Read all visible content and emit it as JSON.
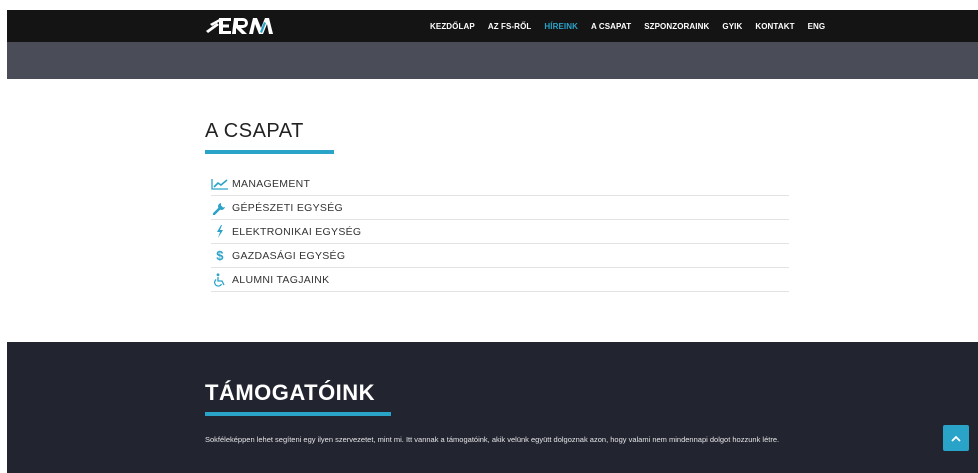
{
  "nav": {
    "logo_text": "ERM",
    "items": [
      {
        "label": "KEZDŐLAP"
      },
      {
        "label": "AZ FS-RŐL"
      },
      {
        "label": "HÍREINK",
        "active": true
      },
      {
        "label": "A CSAPAT"
      },
      {
        "label": "SZPONZORAINK"
      },
      {
        "label": "GYIK"
      },
      {
        "label": "KONTAKT"
      },
      {
        "label": "ENG"
      }
    ]
  },
  "team": {
    "title": "A CSAPAT",
    "items": [
      {
        "label": "MANAGEMENT",
        "icon": "chart-line-icon"
      },
      {
        "label": "GÉPÉSZETI EGYSÉG",
        "icon": "wrench-icon"
      },
      {
        "label": "ELEKTRONIKAI EGYSÉG",
        "icon": "bolt-icon"
      },
      {
        "label": "GAZDASÁGI EGYSÉG",
        "icon": "dollar-icon"
      },
      {
        "label": "ALUMNI TAGJAINK",
        "icon": "wheelchair-icon"
      }
    ]
  },
  "sponsors": {
    "title": "TÁMOGATÓINK",
    "text": "Sokféleképpen lehet segíteni egy ilyen szervezetet, mint mi. Itt vannak a támogatóink, akik velünk együtt dolgoznak azon, hogy valami nem mindennapi dolgot hozzunk létre."
  },
  "colors": {
    "accent": "#2aa3c9",
    "topbar": "#141414",
    "hero": "#4a4d57",
    "footer": "#222430"
  }
}
